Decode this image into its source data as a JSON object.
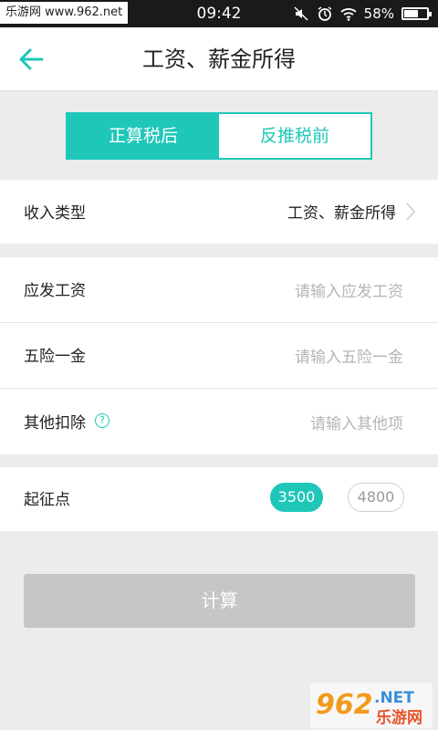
{
  "status_bar": {
    "watermark": "乐游网 www.962.net",
    "time": "09:42",
    "battery": "58%",
    "battery_level": 0.58
  },
  "header": {
    "title": "工资、薪金所得"
  },
  "segment": {
    "options": [
      "正算税后",
      "反推税前"
    ],
    "selected": 0
  },
  "income_type": {
    "label": "收入类型",
    "value": "工资、薪金所得"
  },
  "fields": {
    "gross_salary": {
      "label": "应发工资",
      "placeholder": "请输入应发工资"
    },
    "insurance": {
      "label": "五险一金",
      "placeholder": "请输入五险一金"
    },
    "other": {
      "label": "其他扣除",
      "placeholder": "请输入其他项"
    }
  },
  "threshold": {
    "label": "起征点",
    "options": [
      "3500",
      "4800"
    ],
    "selected": "3500"
  },
  "calculate_label": "计算",
  "watermark_logo": {
    "number": "962",
    "suffix": ".NET",
    "cn": "乐游网"
  },
  "colors": {
    "accent": "#1fc7b9",
    "disabled": "#c6c6c6"
  }
}
